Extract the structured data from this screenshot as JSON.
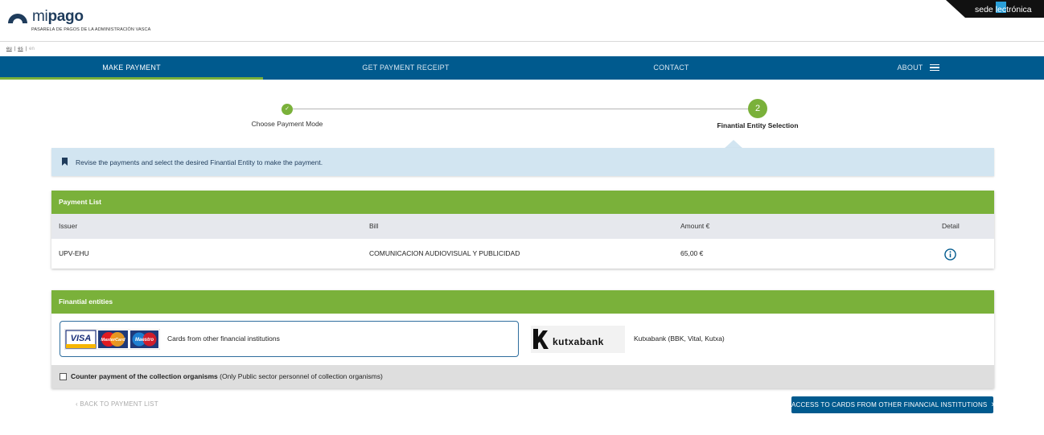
{
  "header": {
    "logo_mi": "mi",
    "logo_pago": "pago",
    "logo_subtitle": "PASARELA DE PAGOS DE LA ADMINISTRACIÓN VASCA",
    "sede_text": "sede  lectrónica"
  },
  "languages": [
    {
      "code": "eu"
    },
    {
      "code": "es"
    },
    {
      "code": "en"
    }
  ],
  "nav": [
    {
      "label": "MAKE PAYMENT"
    },
    {
      "label": "GET PAYMENT RECEIPT"
    },
    {
      "label": "CONTACT"
    },
    {
      "label": "ABOUT"
    }
  ],
  "steps": [
    {
      "number": "✓",
      "label": "Choose Payment Mode"
    },
    {
      "number": "2",
      "label": "Finantial Entity Selection"
    }
  ],
  "info": {
    "text": "Revise the payments and select the desired Finantial Entity to make the payment."
  },
  "payment_list": {
    "title": "Payment List",
    "columns": [
      "Issuer",
      "Bill",
      "Amount €",
      "Detail"
    ],
    "rows": [
      {
        "issuer": "UPV-EHU",
        "bill": "COMUNICACION AUDIOVISUAL Y PUBLICIDAD",
        "amount": "65,00 €"
      }
    ]
  },
  "entities": {
    "title": "Finantial entities",
    "cards_label": "Cards from other financial institutions",
    "kutxa_label": "Kutxabank (BBK, Vital, Kutxa)",
    "counter_bold": "Counter payment of the collection organisms",
    "counter_rest": " (Only Public sector personnel of collection organisms)"
  },
  "actions": {
    "back": "BACK TO PAYMENT LIST",
    "access": "ACCESS TO CARDS FROM OTHER FINANCIAL INSTITUTIONS"
  },
  "colors": {
    "primary": "#005a8e",
    "accent": "#7ab13a",
    "info_bg": "#d2e5f1"
  }
}
